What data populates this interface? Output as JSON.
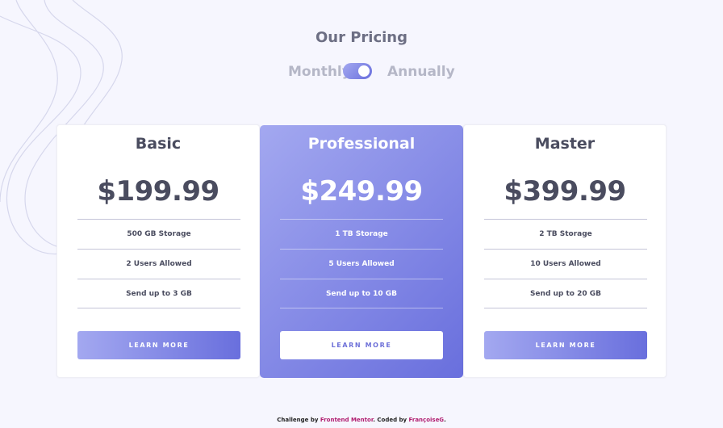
{
  "header": {
    "title": "Our Pricing",
    "toggle": {
      "left_label": "Monthly",
      "right_label": "Annually",
      "state": "annually"
    }
  },
  "plans": [
    {
      "name": "Basic",
      "price": "$199.99",
      "features": [
        "500 GB Storage",
        "2 Users Allowed",
        "Send up to 3 GB"
      ],
      "button": "LEARN MORE"
    },
    {
      "name": "Professional",
      "price": "$249.99",
      "features": [
        "1 TB Storage",
        "5 Users Allowed",
        "Send up to 10 GB"
      ],
      "button": "LEARN MORE"
    },
    {
      "name": "Master",
      "price": "$399.99",
      "features": [
        "2 TB Storage",
        "10 Users Allowed",
        "Send up to 20 GB"
      ],
      "button": "LEARN MORE"
    }
  ],
  "footer": {
    "prefix": "Challenge by ",
    "link1": "Frontend Mentor",
    "middle": ". Coded by ",
    "link2": "FrançoiseG",
    "suffix": "."
  },
  "colors": {
    "background": "#f6f6fe",
    "gradient_start": "#a3a8f0",
    "gradient_end": "#696fdd",
    "text_dark": "#4a4c5f",
    "footer_link": "#b01c6f"
  }
}
